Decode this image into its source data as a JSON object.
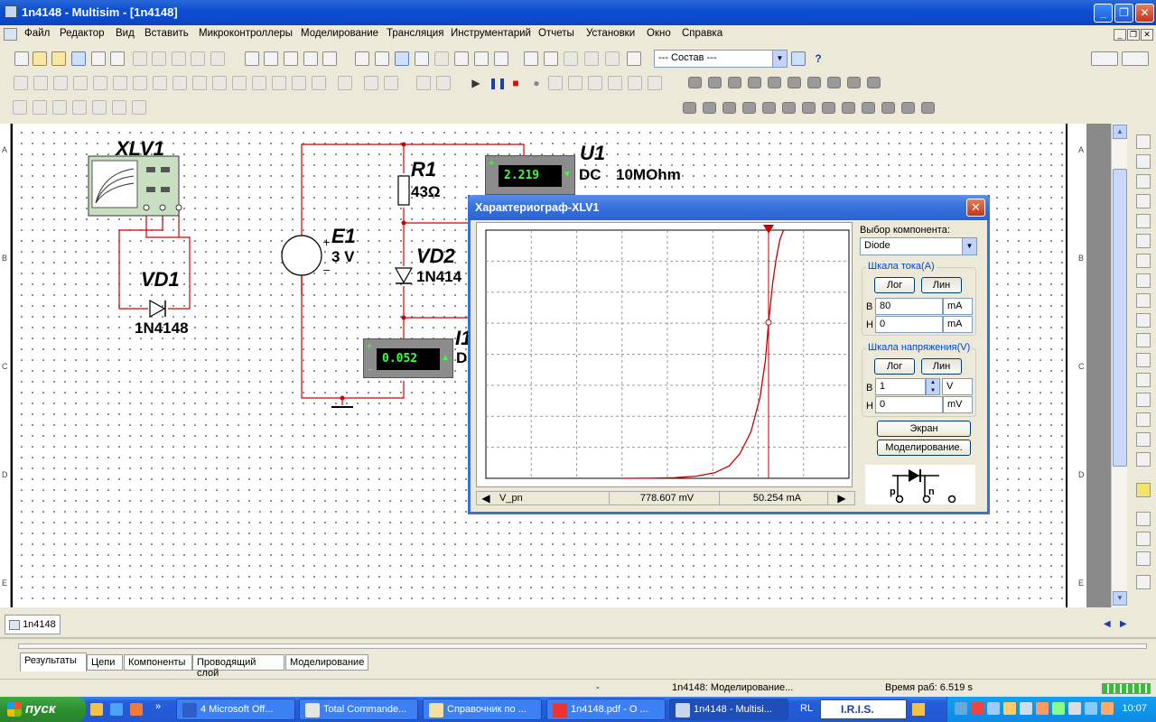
{
  "window": {
    "title": "1n4148 - Multisim - [1n4148]"
  },
  "menu": [
    "Файл",
    "Редактор",
    "Вид",
    "Вставить",
    "Микроконтроллеры",
    "Моделирование",
    "Трансляция",
    "Инструментарий",
    "Отчеты",
    "Установки",
    "Окно",
    "Справка"
  ],
  "toolbar": {
    "set_combo": "--- Состав ---"
  },
  "ruler_rows": [
    "A",
    "B",
    "C",
    "D",
    "E"
  ],
  "schematic": {
    "xlv1": "XLV1",
    "vd1_name": "VD1",
    "vd1_model": "1N4148",
    "r1_name": "R1",
    "r1_value": "43Ω",
    "e1_name": "E1",
    "e1_value": "3 V",
    "vd2_name": "VD2",
    "vd2_model": "1N414",
    "u1_name": "U1",
    "u1_mode": "DC",
    "u1_imp": "10MOhm",
    "u1_reading": "2.219",
    "i1_name": "I1",
    "i1_mode": "D",
    "i1_reading": "0.052"
  },
  "dialog": {
    "title": "Характериограф-XLV1",
    "component_label": "Выбор компонента:",
    "component_value": "Diode",
    "current_scale": {
      "title": "Шкала тока(A)",
      "log": "Лог",
      "lin": "Лин",
      "b_label": "B",
      "b_value": "80",
      "b_unit": "mA",
      "h_label": "H",
      "h_value": "0",
      "h_unit": "mA"
    },
    "voltage_scale": {
      "title": "Шкала напряжения(V)",
      "log": "Лог",
      "lin": "Лин",
      "b_label": "B",
      "b_value": "1",
      "b_unit": "V",
      "h_label": "H",
      "h_value": "0",
      "h_unit": "mV"
    },
    "screen_button": "Экран",
    "simulate_button": "Моделирование.",
    "status_param": "V_pn",
    "status_voltage": "778.607 mV",
    "status_current": "50.254 mA",
    "pin_p": "p",
    "pin_n": "n"
  },
  "doc_tab": "1n4148",
  "panel_tabs": [
    "Результаты",
    "Цепи",
    "Компоненты",
    "Проводящий слой",
    "Моделирование"
  ],
  "statusbar": {
    "dash": "-",
    "sim_status": "1n4148: Моделирование...",
    "runtime": "Время раб: 6.519 s"
  },
  "taskbar": {
    "start": "пуск",
    "tasks": [
      "4 Microsoft Off...",
      "Total Commande...",
      "Справочник по ...",
      "1n4148.pdf - O ...",
      "1n4148 - Multisi..."
    ],
    "lang": "RL",
    "iris": "I.R.I.S.",
    "clock": "10:07"
  },
  "chart_data": {
    "type": "line",
    "xlim": [
      0,
      1
    ],
    "ylim": [
      0,
      80
    ],
    "x_unit": "V",
    "y_unit": "mA",
    "series": [
      {
        "x": [
          0.38,
          0.46,
          0.52,
          0.58,
          0.63,
          0.67,
          0.7,
          0.73,
          0.755,
          0.77,
          0.7786,
          0.79,
          0.8,
          0.81,
          0.82
        ],
        "y": [
          0,
          0.05,
          0.2,
          0.7,
          1.8,
          4,
          8,
          15,
          26,
          38,
          50.25,
          63,
          71,
          77,
          80
        ]
      }
    ],
    "cursor_x": 0.7786,
    "cursor_point": [
      0.7786,
      50.254
    ]
  }
}
